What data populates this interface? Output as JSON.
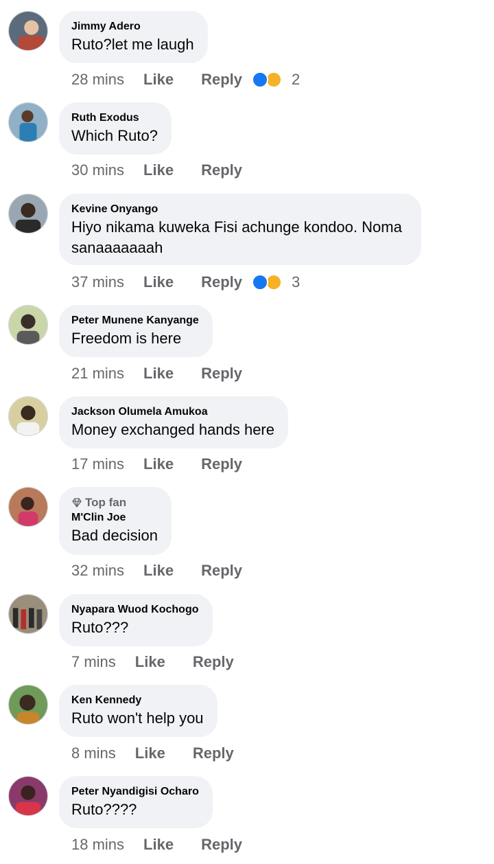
{
  "comments": [
    {
      "author": "Jimmy Adero",
      "text": "Ruto?let me laugh",
      "time": "28 mins",
      "like_label": "Like",
      "reply_label": "Reply",
      "reaction_count": "2",
      "avatar_colors": [
        "#5b6b7c",
        "#b24a3a"
      ]
    },
    {
      "author": "Ruth Exodus",
      "text": "Which Ruto?",
      "time": "30 mins",
      "like_label": "Like",
      "reply_label": "Reply",
      "avatar_colors": [
        "#8fb0c6",
        "#2d7fb3"
      ]
    },
    {
      "author": "Kevine Onyango",
      "text": "Hiyo nikama kuweka Fisi achunge kondoo. Noma sanaaaaaaah",
      "time": "37 mins",
      "like_label": "Like",
      "reply_label": "Reply",
      "reaction_count": "3",
      "avatar_colors": [
        "#9aa7b2",
        "#2a2a2a"
      ]
    },
    {
      "author": "Peter Munene Kanyange",
      "text": "Freedom is here",
      "time": "21 mins",
      "like_label": "Like",
      "reply_label": "Reply",
      "avatar_colors": [
        "#c9d6a8",
        "#3a2e2a"
      ]
    },
    {
      "author": "Jackson Olumela Amukoa",
      "text": "Money exchanged hands here",
      "time": "17 mins",
      "like_label": "Like",
      "reply_label": "Reply",
      "avatar_colors": [
        "#d8cfa0",
        "#3b2a22"
      ]
    },
    {
      "author": "M'Clin Joe",
      "badge": "Top fan",
      "text": "Bad decision",
      "time": "32 mins",
      "like_label": "Like",
      "reply_label": "Reply",
      "avatar_colors": [
        "#b87a5a",
        "#d23a6a"
      ]
    },
    {
      "author": "Nyapara Wuod Kochogo",
      "text": "Ruto???",
      "time": "7 mins",
      "like_label": "Like",
      "reply_label": "Reply",
      "avatar_colors": [
        "#9a8f7a",
        "#2b2b2b"
      ]
    },
    {
      "author": "Ken Kennedy",
      "text": "Ruto won't help you",
      "time": "8 mins",
      "like_label": "Like",
      "reply_label": "Reply",
      "avatar_colors": [
        "#6f9a5a",
        "#c8862a"
      ]
    },
    {
      "author": "Peter Nyandigisi Ocharo",
      "text": "Ruto????",
      "time": "18 mins",
      "like_label": "Like",
      "reply_label": "Reply",
      "avatar_colors": [
        "#8a3a6a",
        "#d8354a"
      ]
    }
  ]
}
